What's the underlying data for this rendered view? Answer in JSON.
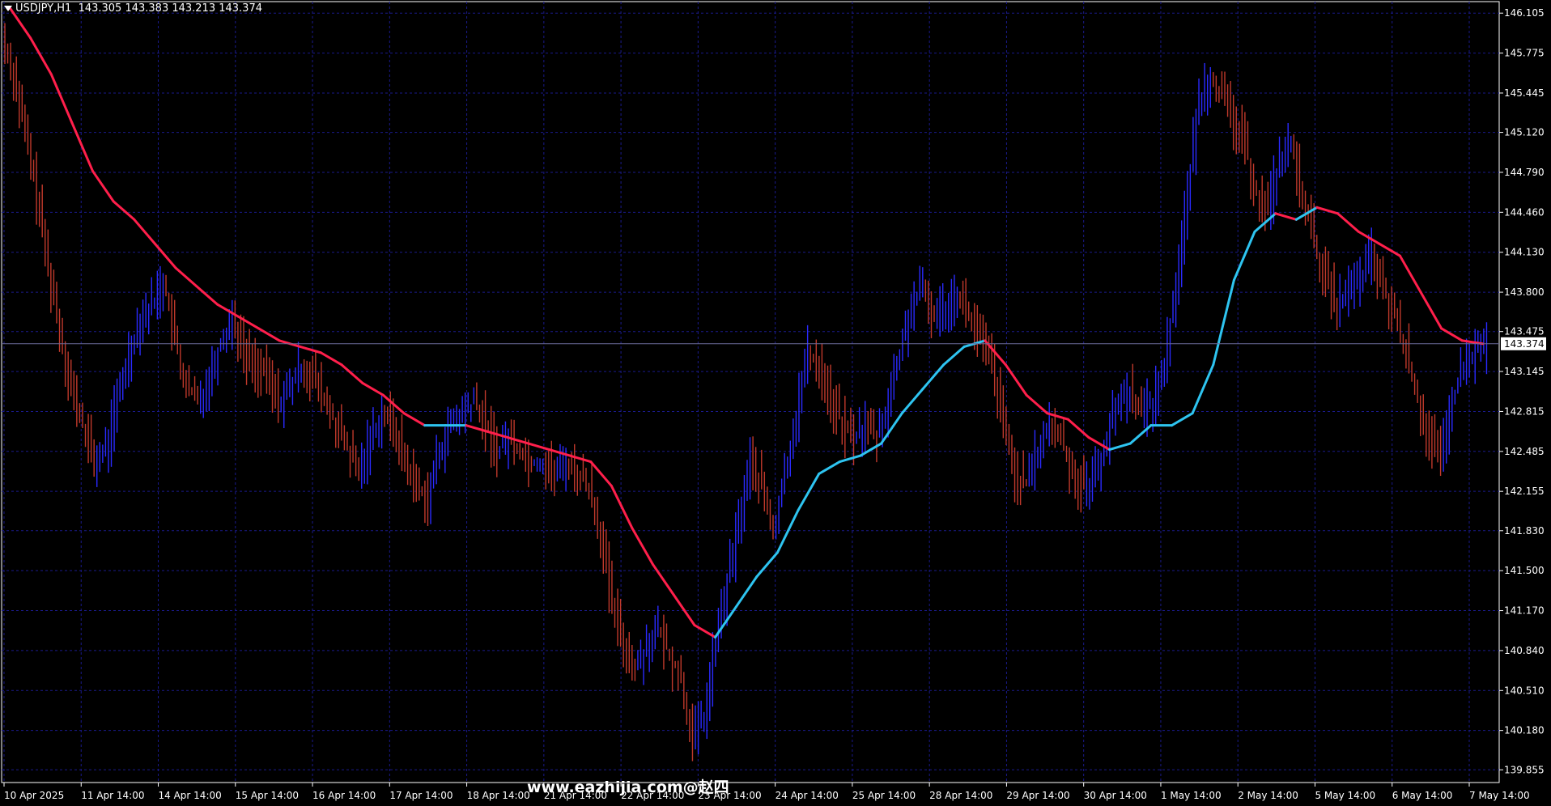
{
  "header": {
    "symbol": "USDJPY,H1",
    "ohlc": "143.305 143.383 143.213 143.374"
  },
  "watermark": "www.eazhijia.com@赵四",
  "colors": {
    "background": "#000000",
    "grid": "#1a1a8c",
    "axis": "#ffffff",
    "bull_bar": "#2a2aff",
    "bear_bar": "#c0392b",
    "ma_up": "#2ec4f0",
    "ma_down": "#ff1f4b",
    "price_tag_bg": "#ffffff",
    "price_tag_text": "#000000"
  },
  "chart_data": {
    "type": "line",
    "title": "USDJPY,H1",
    "current_price": "143.374",
    "ylim": [
      139.75,
      146.2
    ],
    "y_ticks": [
      "146.105",
      "145.775",
      "145.445",
      "145.120",
      "144.790",
      "144.460",
      "144.130",
      "143.800",
      "143.475",
      "143.145",
      "142.815",
      "142.485",
      "142.155",
      "141.830",
      "141.500",
      "141.170",
      "140.840",
      "140.510",
      "140.180",
      "139.855"
    ],
    "x_labels": [
      "10 Apr 2025",
      "11 Apr 14:00",
      "14 Apr 14:00",
      "15 Apr 14:00",
      "16 Apr 14:00",
      "17 Apr 14:00",
      "18 Apr 14:00",
      "21 Apr 14:00",
      "22 Apr 14:00",
      "23 Apr 14:00",
      "24 Apr 14:00",
      "25 Apr 14:00",
      "28 Apr 14:00",
      "29 Apr 14:00",
      "30 Apr 14:00",
      "1 May 14:00",
      "2 May 14:00",
      "5 May 14:00",
      "6 May 14:00",
      "7 May 14:00"
    ],
    "grid": true,
    "price_bars_close": [
      145.6,
      145.1,
      144.6,
      144.0,
      143.5,
      143.0,
      142.7,
      142.4,
      142.5,
      142.9,
      143.3,
      143.6,
      143.7,
      143.9,
      143.4,
      143.0,
      142.9,
      143.1,
      143.4,
      143.6,
      143.3,
      143.2,
      143.1,
      142.9,
      143.0,
      143.2,
      143.1,
      142.9,
      142.7,
      142.5,
      142.3,
      142.6,
      142.8,
      142.7,
      142.4,
      142.2,
      142.1,
      142.5,
      142.7,
      142.8,
      142.9,
      142.7,
      142.5,
      142.6,
      142.5,
      142.4,
      142.4,
      142.3,
      142.4,
      142.3,
      142.2,
      141.8,
      141.2,
      140.9,
      140.7,
      140.9,
      141.0,
      140.8,
      140.6,
      140.1,
      140.3,
      140.9,
      141.4,
      141.9,
      142.4,
      142.2,
      141.8,
      142.3,
      142.8,
      143.3,
      143.2,
      142.9,
      142.7,
      142.6,
      142.7,
      142.6,
      142.9,
      143.3,
      143.7,
      143.8,
      143.6,
      143.7,
      143.8,
      143.6,
      143.4,
      143.2,
      142.7,
      142.3,
      142.2,
      142.5,
      142.7,
      142.6,
      142.3,
      142.2,
      142.3,
      142.6,
      142.9,
      143.0,
      142.8,
      142.9,
      143.2,
      143.9,
      144.6,
      145.4,
      145.6,
      145.4,
      145.2,
      145.0,
      144.6,
      144.5,
      144.9,
      145.0,
      144.6,
      144.2,
      143.9,
      143.7,
      143.8,
      143.9,
      144.1,
      143.8,
      143.6,
      143.3,
      142.9,
      142.6,
      142.4,
      142.9,
      143.2,
      143.3,
      143.374
    ],
    "series": [
      {
        "name": "",
        "description_colors": "cyan when rising, red when falling",
        "values": [
          146.15,
          145.9,
          145.6,
          145.2,
          144.8,
          144.55,
          144.4,
          144.2,
          144.0,
          143.85,
          143.7,
          143.6,
          143.5,
          143.4,
          143.35,
          143.3,
          143.2,
          143.05,
          142.95,
          142.8,
          142.7,
          142.7,
          142.7,
          142.65,
          142.6,
          142.55,
          142.5,
          142.45,
          142.4,
          142.2,
          141.85,
          141.55,
          141.3,
          141.05,
          140.95,
          141.2,
          141.45,
          141.65,
          142.0,
          142.3,
          142.4,
          142.45,
          142.55,
          142.8,
          143.0,
          143.2,
          143.35,
          143.4,
          143.2,
          142.95,
          142.8,
          142.75,
          142.6,
          142.5,
          142.55,
          142.7,
          142.7,
          142.8,
          143.2,
          143.9,
          144.3,
          144.45,
          144.4,
          144.5,
          144.45,
          144.3,
          144.2,
          144.1,
          143.8,
          143.5,
          143.4,
          143.374
        ]
      }
    ]
  }
}
